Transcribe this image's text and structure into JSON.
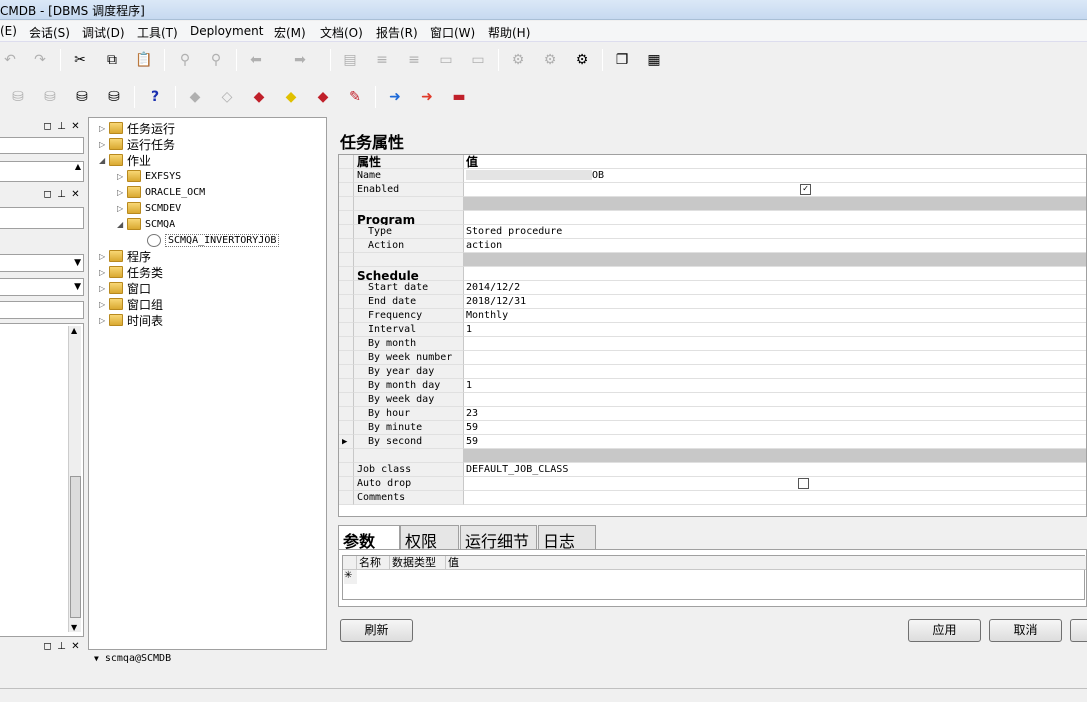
{
  "window": {
    "title": "CMDB - [DBMS 调度程序]"
  },
  "menu": [
    "(E)",
    "会话(S)",
    "调试(D)",
    "工具(T)",
    "Deployment",
    "宏(M)",
    "文档(O)",
    "报告(R)",
    "窗口(W)",
    "帮助(H)"
  ],
  "toolbar": {
    "help_glyph": "?"
  },
  "tree": {
    "items": [
      {
        "label": "任务运行"
      },
      {
        "label": "运行任务"
      },
      {
        "label": "作业"
      },
      {
        "label": "EXFSYS"
      },
      {
        "label": "ORACLE_OCM"
      },
      {
        "label": "SCMDEV"
      },
      {
        "label": "SCMQA"
      },
      {
        "label": "SCMQA_INVERTORYJOB"
      },
      {
        "label": "程序"
      },
      {
        "label": "任务类"
      },
      {
        "label": "窗口"
      },
      {
        "label": "窗口组"
      },
      {
        "label": "时间表"
      }
    ],
    "connection": "scmqa@SCMDB"
  },
  "properties": {
    "title": "任务属性",
    "col_property": "属性",
    "col_value": "值",
    "name_key": "Name",
    "name_value": "OB",
    "enabled_key": "Enabled",
    "enabled": true,
    "program_category": "Program",
    "type_key": "Type",
    "type_value": "Stored procedure",
    "action_key": "Action",
    "action_value": "action",
    "schedule_category": "Schedule",
    "start_date_key": "Start date",
    "start_date_value": "2014/12/2",
    "end_date_key": "End date",
    "end_date_value": "2018/12/31",
    "frequency_key": "Frequency",
    "frequency_value": "Monthly",
    "interval_key": "Interval",
    "interval_value": "1",
    "by_month_key": "By month",
    "by_week_number_key": "By week number",
    "by_year_day_key": "By year day",
    "by_month_day_key": "By month day",
    "by_month_day_value": "1",
    "by_week_day_key": "By week day",
    "by_hour_key": "By hour",
    "by_hour_value": "23",
    "by_minute_key": "By minute",
    "by_minute_value": "59",
    "by_second_key": "By second",
    "by_second_value": "59",
    "job_class_key": "Job class",
    "job_class_value": "DEFAULT_JOB_CLASS",
    "auto_drop_key": "Auto drop",
    "auto_drop": false,
    "comments_key": "Comments"
  },
  "tabs": [
    "参数",
    "权限",
    "运行细节",
    "日志"
  ],
  "params_grid": {
    "col_name": "名称",
    "col_type": "数据类型",
    "col_value": "值",
    "new_row_marker": "✳"
  },
  "buttons": {
    "refresh": "刷新",
    "apply": "应用",
    "cancel": "取消"
  }
}
